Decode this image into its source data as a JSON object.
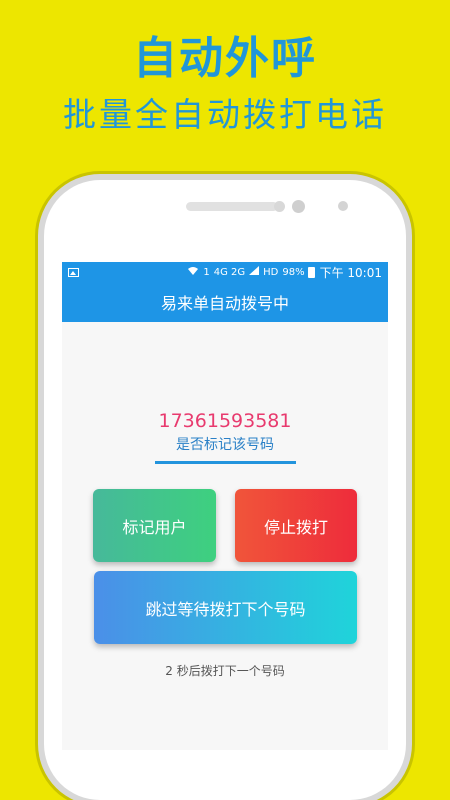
{
  "promo": {
    "title": "自动外呼",
    "subtitle": "批量全自动拨打电话"
  },
  "status_bar": {
    "sim": "1",
    "network": "4G 2G",
    "hd": "HD",
    "battery": "98%",
    "time": "下午 10:01"
  },
  "app_bar": {
    "title": "易来单自动拨号中"
  },
  "call": {
    "number": "17361593581",
    "mark_prompt": "是否标记该号码"
  },
  "buttons": {
    "mark_user": "标记用户",
    "stop_dialing": "停止拨打",
    "skip_wait": "跳过等待拨打下个号码"
  },
  "countdown_text": "2 秒后拨打下一个号码",
  "colors": {
    "background": "#ede600",
    "primary": "#1e95e6",
    "number": "#e83a6e"
  }
}
